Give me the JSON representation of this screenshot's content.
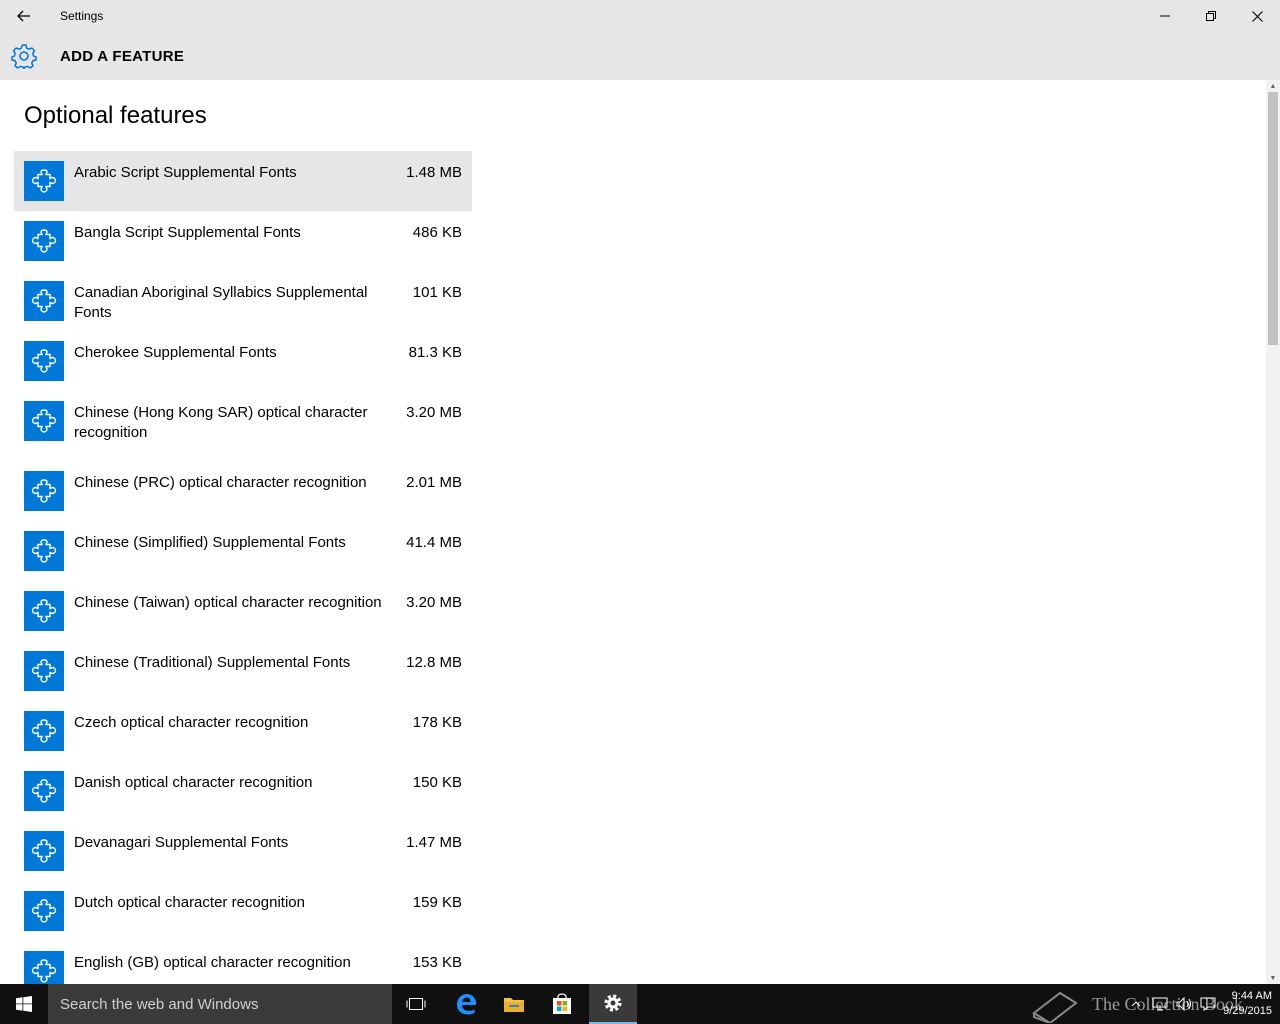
{
  "window": {
    "title": "Settings"
  },
  "header": {
    "title": "ADD A FEATURE"
  },
  "page": {
    "title": "Optional features"
  },
  "features": [
    {
      "name": "Arabic Script Supplemental Fonts",
      "size": "1.48 MB"
    },
    {
      "name": "Bangla Script Supplemental Fonts",
      "size": "486 KB"
    },
    {
      "name": "Canadian Aboriginal Syllabics Supplemental Fonts",
      "size": "101 KB"
    },
    {
      "name": "Cherokee Supplemental Fonts",
      "size": "81.3 KB"
    },
    {
      "name": "Chinese (Hong Kong SAR) optical character recognition",
      "size": "3.20 MB"
    },
    {
      "name": "Chinese (PRC) optical character recognition",
      "size": "2.01 MB"
    },
    {
      "name": "Chinese (Simplified) Supplemental Fonts",
      "size": "41.4 MB"
    },
    {
      "name": "Chinese (Taiwan) optical character recognition",
      "size": "3.20 MB"
    },
    {
      "name": "Chinese (Traditional) Supplemental Fonts",
      "size": "12.8 MB"
    },
    {
      "name": "Czech optical character recognition",
      "size": "178 KB"
    },
    {
      "name": "Danish optical character recognition",
      "size": "150 KB"
    },
    {
      "name": "Devanagari Supplemental Fonts",
      "size": "1.47 MB"
    },
    {
      "name": "Dutch optical character recognition",
      "size": "159 KB"
    },
    {
      "name": "English (GB) optical character recognition",
      "size": "153 KB"
    }
  ],
  "taskbar": {
    "search_placeholder": "Search the web and Windows",
    "time": "9:44 AM",
    "date": "9/29/2015",
    "watermark": "The Collection Book"
  },
  "colors": {
    "accent": "#0078d7",
    "chrome": "#e6e6e6",
    "taskbar": "#101010"
  },
  "icons": {
    "back": "back-arrow-icon",
    "settings": "gear-icon",
    "feature": "puzzle-piece-icon"
  }
}
